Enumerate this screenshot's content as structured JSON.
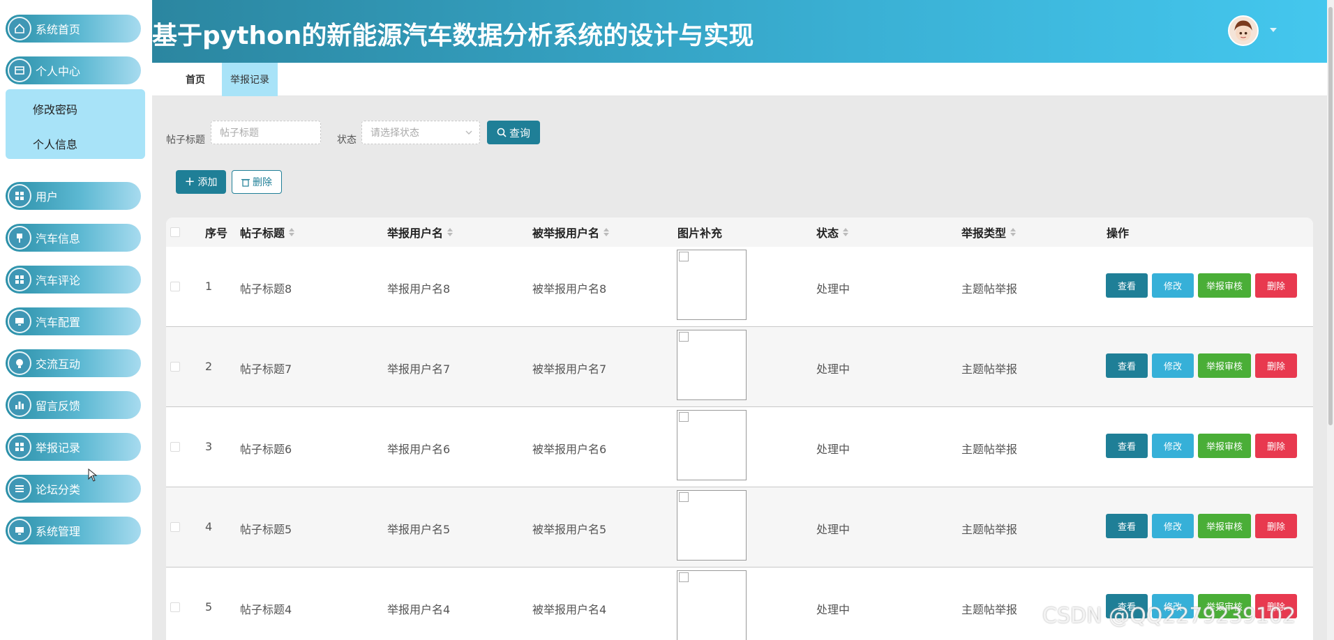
{
  "app": {
    "title": "基于python的新能源汽车数据分析系统的设计与实现"
  },
  "sidebar": {
    "items": [
      {
        "label": "系统首页",
        "icon": "home-icon"
      },
      {
        "label": "个人中心",
        "icon": "profile-icon"
      },
      {
        "label": "用户",
        "icon": "grid-icon"
      },
      {
        "label": "汽车信息",
        "icon": "pin-icon"
      },
      {
        "label": "汽车评论",
        "icon": "grid-icon"
      },
      {
        "label": "汽车配置",
        "icon": "monitor-icon"
      },
      {
        "label": "交流互动",
        "icon": "bulb-icon"
      },
      {
        "label": "留言反馈",
        "icon": "chart-icon"
      },
      {
        "label": "举报记录",
        "icon": "grid-icon"
      },
      {
        "label": "论坛分类",
        "icon": "list-icon"
      },
      {
        "label": "系统管理",
        "icon": "monitor-icon"
      }
    ],
    "submenu": [
      {
        "label": "修改密码"
      },
      {
        "label": "个人信息"
      }
    ]
  },
  "tabs": [
    {
      "label": "首页"
    },
    {
      "label": "举报记录"
    }
  ],
  "search": {
    "title_label": "帖子标题",
    "title_placeholder": "帖子标题",
    "status_label": "状态",
    "status_placeholder": "请选择状态",
    "query_label": "查询"
  },
  "toolbar": {
    "add_label": "添加",
    "delete_label": "删除"
  },
  "table": {
    "columns": [
      "序号",
      "帖子标题",
      "举报用户名",
      "被举报用户名",
      "图片补充",
      "状态",
      "举报类型",
      "操作"
    ],
    "rows": [
      {
        "index": "1",
        "title": "帖子标题8",
        "reporter": "举报用户名8",
        "reported": "被举报用户名8",
        "status": "处理中",
        "type": "主题帖举报"
      },
      {
        "index": "2",
        "title": "帖子标题7",
        "reporter": "举报用户名7",
        "reported": "被举报用户名7",
        "status": "处理中",
        "type": "主题帖举报"
      },
      {
        "index": "3",
        "title": "帖子标题6",
        "reporter": "举报用户名6",
        "reported": "被举报用户名6",
        "status": "处理中",
        "type": "主题帖举报"
      },
      {
        "index": "4",
        "title": "帖子标题5",
        "reporter": "举报用户名5",
        "reported": "被举报用户名5",
        "status": "处理中",
        "type": "主题帖举报"
      },
      {
        "index": "5",
        "title": "帖子标题4",
        "reporter": "举报用户名4",
        "reported": "被举报用户名4",
        "status": "处理中",
        "type": "主题帖举报"
      }
    ],
    "actions": {
      "view": "查看",
      "edit": "修改",
      "audit": "举报审核",
      "delete": "删除"
    }
  },
  "watermark": "CSDN @QQ2279239102",
  "colors": {
    "primary": "#1f7f97",
    "edit": "#36b0d8",
    "audit": "#4aae37",
    "danger": "#e8394f",
    "active_tab": "#a8e3f8"
  }
}
